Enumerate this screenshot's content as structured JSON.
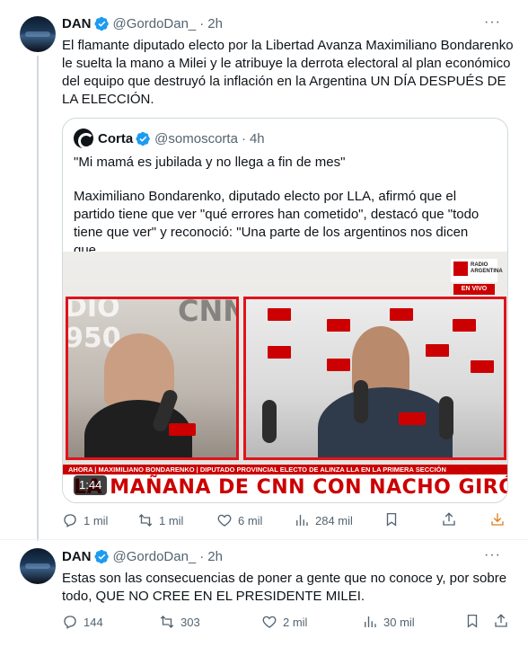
{
  "tweet1": {
    "name": "DAN",
    "handle": "@GordoDan_",
    "dot": "·",
    "time": "2h",
    "more": "···",
    "text": "El flamante diputado electo por la Libertad Avanza Maximiliano Bondarenko le suelta la mano a Milei y le atribuye la derrota electoral al plan económico del equipo que destruyó la inflación en la Argentina UN DÍA DESPUÉS DE LA ELECCIÓN.",
    "quote": {
      "name": "Corta",
      "handle": "@somoscorta",
      "dot": "·",
      "time": "4h",
      "line1": "\"Mi mamá es jubilada y no llega a fin de mes\"",
      "line2": "Maximiliano Bondarenko, diputado electo por LLA, afirmó que el partido tiene que ver \"qué errores han cometido\", destacó que \"todo tiene que ver\" y reconoció: \"Una parte de los argentinos nos dicen que...",
      "media": {
        "duration": "1:44",
        "ticker": "AHORA | MAXIMILIANO BONDARENKO | DIPUTADO PROVINCIAL ELECTO DE ALINZA LLA EN LA PRIMERA SECCIÓN",
        "show_title": "LA MAÑANA DE CNN CON NACHO GIRÓN",
        "logo_text": "RADIO ARGENTINA",
        "live_badge": "EN VIVO",
        "wall_text": "CNN",
        "wall_text_left": "DIO",
        "wall_text_left2": "950"
      }
    },
    "actions": {
      "replies": "1 mil",
      "reposts": "1 mil",
      "likes": "6 mil",
      "views": "284 mil"
    }
  },
  "tweet2": {
    "name": "DAN",
    "handle": "@GordoDan_",
    "dot": "·",
    "time": "2h",
    "more": "···",
    "text": "Estas son las consecuencias de poner a gente que no conoce y, por sobre todo, QUE NO CREE EN EL PRESIDENTE MILEI.",
    "actions": {
      "replies": "144",
      "reposts": "303",
      "likes": "2 mil",
      "views": "30 mil"
    }
  },
  "colors": {
    "verified": "#1d9bf0",
    "accent_download": "#e0801d",
    "cnn_red": "#cc0000",
    "muted": "#536471"
  },
  "icons": [
    "verified-badge-icon",
    "reply-icon",
    "repost-icon",
    "like-icon",
    "views-icon",
    "bookmark-icon",
    "share-icon",
    "download-icon"
  ]
}
